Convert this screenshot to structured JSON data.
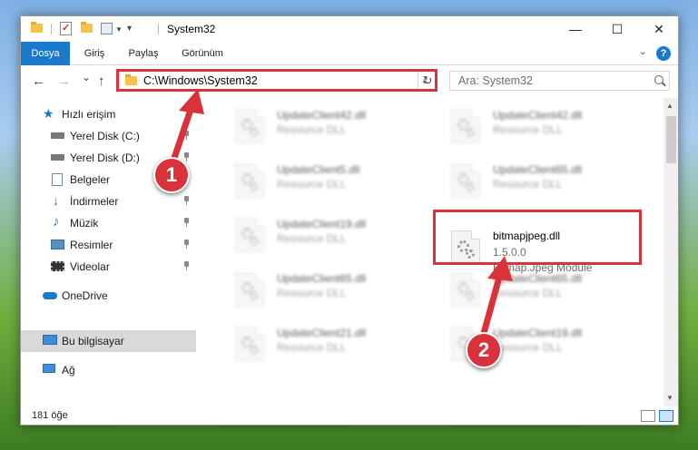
{
  "window": {
    "title": "System32",
    "controls": {
      "minimize": "—",
      "maximize": "☐",
      "close": "✕"
    }
  },
  "ribbon": {
    "tabs": [
      "Dosya",
      "Giriş",
      "Paylaş",
      "Görünüm"
    ],
    "help": "?"
  },
  "navigation": {
    "back": "←",
    "forward": "→",
    "recent": "⌄",
    "up": "↑",
    "address": "C:\\Windows\\System32",
    "address_dropdown": "⌄",
    "refresh": "↻",
    "search_placeholder": "Ara: System32"
  },
  "sidebar": {
    "items": [
      {
        "label": "Hızlı erişim",
        "icon": "star-icon"
      },
      {
        "label": "Yerel Disk (C:)",
        "icon": "drive-icon",
        "pinned": true
      },
      {
        "label": "Yerel Disk (D:)",
        "icon": "drive-icon",
        "pinned": true
      },
      {
        "label": "Belgeler",
        "icon": "documents-icon",
        "pinned": true
      },
      {
        "label": "İndirmeler",
        "icon": "download-icon",
        "pinned": true
      },
      {
        "label": "Müzik",
        "icon": "music-icon",
        "pinned": true
      },
      {
        "label": "Resimler",
        "icon": "pictures-icon",
        "pinned": true
      },
      {
        "label": "Videolar",
        "icon": "videos-icon",
        "pinned": true
      },
      {
        "label": "OneDrive",
        "icon": "cloud-icon"
      },
      {
        "label": "Bu bilgisayar",
        "icon": "computer-icon",
        "selected": true
      },
      {
        "label": "Ağ",
        "icon": "network-icon"
      }
    ]
  },
  "files": {
    "left_column": [
      {
        "name": "UpdateClient42.dll",
        "type": "Resource DLL"
      },
      {
        "name": "UpdateClient5.dll",
        "type": "Resource DLL"
      },
      {
        "name": "UpdateClient19.dll",
        "type": "Resource DLL"
      },
      {
        "name": "UpdateClient65.dll",
        "type": "Resource DLL"
      },
      {
        "name": "UpdateClient21.dll",
        "type": "Resource DLL"
      }
    ],
    "right_column": [
      {
        "name": "UpdateClient42.dll",
        "type": "Resource DLL"
      },
      {
        "name": "UpdateClient65.dll",
        "type": "Resource DLL"
      },
      {
        "name": "UpdateClient65.dll",
        "type": "Resource DLL"
      },
      {
        "name": "UpdateClient19.dll",
        "type": "Resource DLL"
      }
    ],
    "highlighted": {
      "name": "bitmapjpeg.dll",
      "version": "1.5.0.0",
      "description": "Bitmap.Jpeg Module"
    }
  },
  "status": {
    "item_count": "181 öğe"
  },
  "annotations": {
    "callout_1": "1",
    "callout_2": "2",
    "color": "#d9323a"
  },
  "colors": {
    "accent": "#1979ca",
    "highlight": "#d9323a"
  }
}
